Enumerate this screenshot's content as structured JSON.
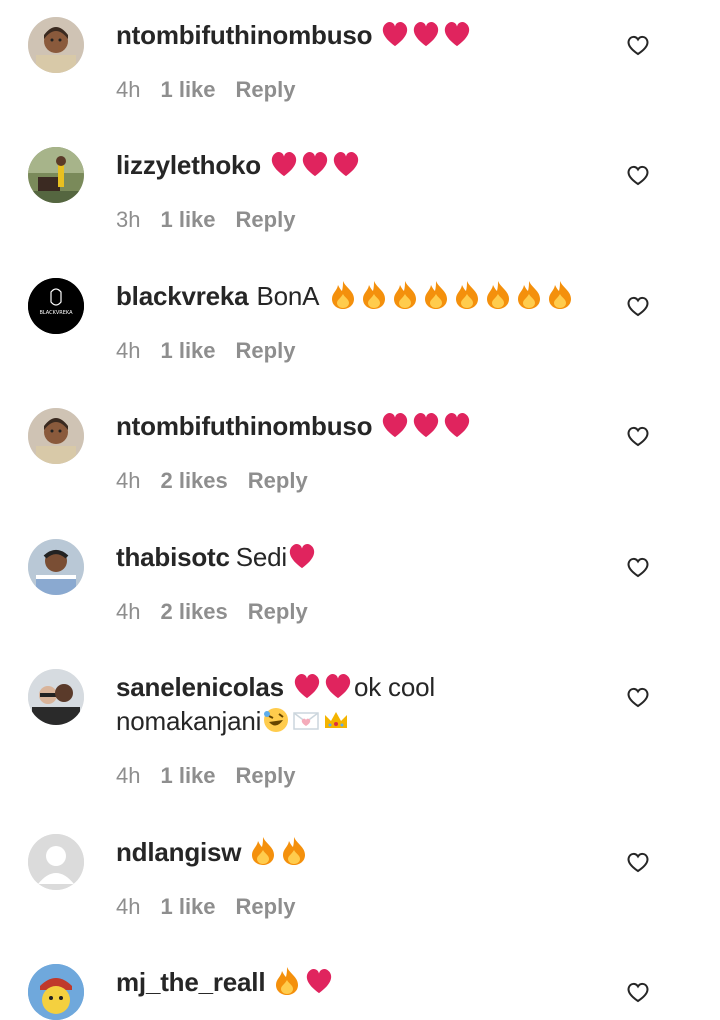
{
  "comments": [
    {
      "username": "ntombifuthinombuso",
      "body": "",
      "emojis": [
        "red-heart",
        "red-heart",
        "red-heart"
      ],
      "time": "4h",
      "likes": "1 like",
      "reply": "Reply",
      "avatar": "avatar-ntombi"
    },
    {
      "username": "lizzylethoko",
      "body": "",
      "emojis": [
        "red-heart",
        "red-heart",
        "red-heart"
      ],
      "time": "3h",
      "likes": "1 like",
      "reply": "Reply",
      "avatar": "avatar-lizzy"
    },
    {
      "username": "blackvreka",
      "body": "BonA",
      "emojis": [
        "fire",
        "fire",
        "fire",
        "fire",
        "fire",
        "fire",
        "fire",
        "fire"
      ],
      "time": "4h",
      "likes": "1 like",
      "reply": "Reply",
      "avatar": "avatar-blackvreka",
      "avatar_text": "BLACKVREKA"
    },
    {
      "username": "ntombifuthinombuso",
      "body": "",
      "emojis": [
        "red-heart",
        "red-heart",
        "red-heart"
      ],
      "time": "4h",
      "likes": "2 likes",
      "reply": "Reply",
      "avatar": "avatar-ntombi"
    },
    {
      "username": "thabisotc",
      "body": "Sedi",
      "emojis": [
        "red-heart"
      ],
      "time": "4h",
      "likes": "2 likes",
      "reply": "Reply",
      "avatar": "avatar-thabiso"
    },
    {
      "username": "sanelenicolas",
      "body": "ok cool",
      "body2": "nomakanjani",
      "emojis": [
        "red-heart",
        "red-heart"
      ],
      "emojis2": [
        "rolling-laughing",
        "love-letter",
        "crown"
      ],
      "time": "4h",
      "likes": "1 like",
      "reply": "Reply",
      "avatar": "avatar-sanele"
    },
    {
      "username": "ndlangisw",
      "body": "",
      "emojis": [
        "fire",
        "fire"
      ],
      "time": "4h",
      "likes": "1 like",
      "reply": "Reply",
      "avatar": "avatar-default"
    },
    {
      "username": "mj_the_reall",
      "body": "",
      "emojis": [
        "fire",
        "red-heart"
      ],
      "time": "",
      "likes": "",
      "reply": "",
      "avatar": "avatar-mj"
    }
  ],
  "icons": {
    "like": "heart-outline-icon"
  },
  "colors": {
    "username": "#262626",
    "meta": "#8e8e8e",
    "emoji_heart": "#e0245e",
    "fire": "#f4900c"
  }
}
